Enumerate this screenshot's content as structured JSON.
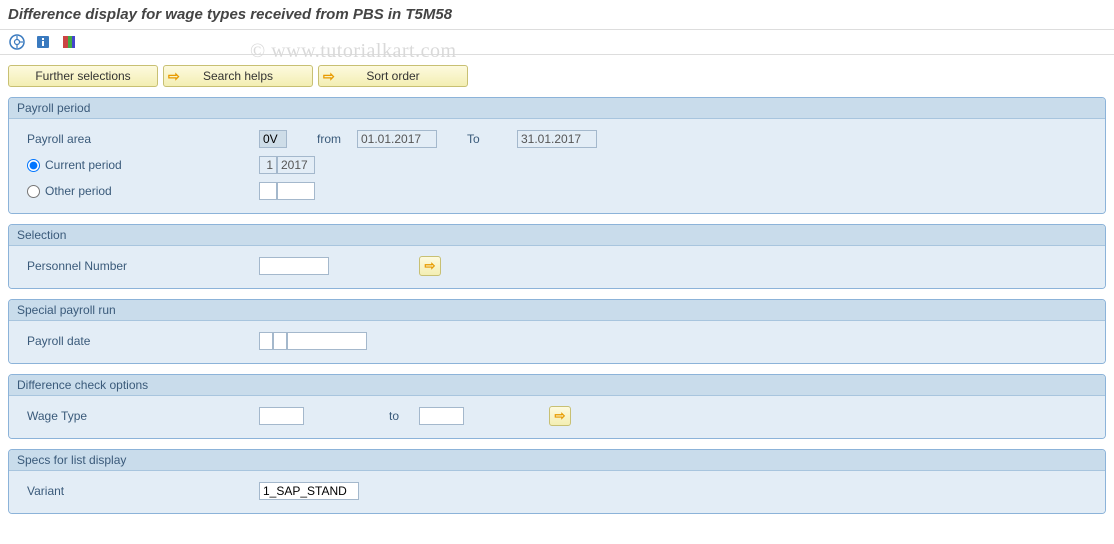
{
  "title": "Difference display for wage types received from PBS in T5M58",
  "watermark": "© www.tutorialkart.com",
  "buttons": {
    "further_selections": "Further selections",
    "search_helps": "Search helps",
    "sort_order": "Sort order"
  },
  "sections": {
    "payroll_period": {
      "title": "Payroll period",
      "payroll_area_label": "Payroll area",
      "payroll_area_value": "0V",
      "from_label": "from",
      "from_value": "01.01.2017",
      "to_label": "To",
      "to_value": "31.01.2017",
      "current_period_label": "Current period",
      "current_period_num": "1",
      "current_period_year": "2017",
      "other_period_label": "Other period",
      "other_period_num": "",
      "other_period_year": ""
    },
    "selection": {
      "title": "Selection",
      "personnel_number_label": "Personnel Number",
      "personnel_number_value": ""
    },
    "special_payroll": {
      "title": "Special payroll run",
      "payroll_date_label": "Payroll date",
      "payroll_date_v1": "",
      "payroll_date_v2": "",
      "payroll_date_v3": ""
    },
    "diff_check": {
      "title": "Difference check options",
      "wage_type_label": "Wage Type",
      "wage_type_from": "",
      "to_label": "to",
      "wage_type_to": ""
    },
    "specs": {
      "title": "Specs for list display",
      "variant_label": "Variant",
      "variant_value": "1_SAP_STAND"
    }
  }
}
